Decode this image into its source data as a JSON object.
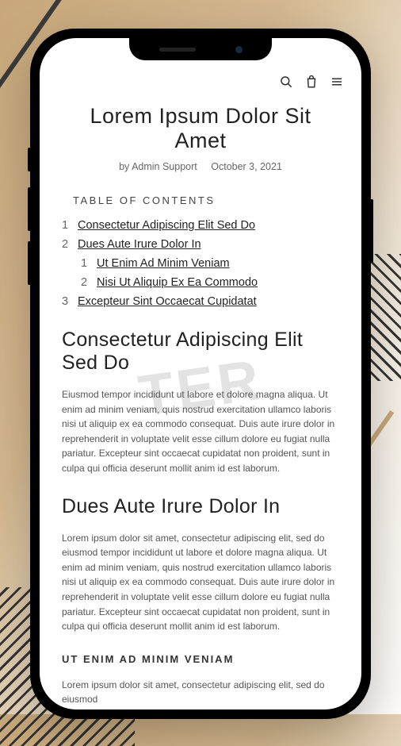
{
  "article": {
    "title": "Lorem Ipsum Dolor Sit Amet",
    "byline_author": "by Admin Support",
    "byline_date": "October 3, 2021"
  },
  "toc": {
    "heading": "TABLE OF CONTENTS",
    "items": {
      "n1": "1",
      "t1": "Consectetur Adipiscing Elit Sed Do",
      "n2": "2",
      "t2": "Dues Aute Irure Dolor In",
      "n2a": "1",
      "t2a": "Ut Enim Ad Minim Veniam",
      "n2b": "2",
      "t2b": "Nisi Ut Aliquip Ex Ea Commodo",
      "n3": "3",
      "t3": "Excepteur Sint Occaecat Cupidatat"
    }
  },
  "sections": {
    "h1": "Consectetur Adipiscing Elit Sed Do",
    "p1": "Eiusmod tempor incididunt ut labore et dolore magna aliqua. Ut enim ad minim veniam, quis nostrud exercitation ullamco laboris nisi ut aliquip ex ea commodo consequat. Duis aute irure dolor in reprehenderit in voluptate velit esse cillum dolore eu fugiat nulla pariatur. Excepteur sint occaecat cupidatat non proident, sunt in culpa qui officia deserunt mollit anim id est laborum.",
    "h2": "Dues Aute Irure Dolor In",
    "p2": "Lorem ipsum dolor sit amet, consectetur adipiscing elit, sed do eiusmod tempor incididunt ut labore et dolore magna aliqua. Ut enim ad minim veniam, quis nostrud exercitation ullamco laboris nisi ut aliquip ex ea commodo consequat. Duis aute irure dolor in reprehenderit in voluptate velit esse cillum dolore eu fugiat nulla pariatur. Excepteur sint occaecat cupidatat non proident, sunt in culpa qui officia deserunt mollit anim id est laborum.",
    "h3": "UT ENIM AD MINIM VENIAM",
    "p3": "Lorem ipsum dolor sit amet, consectetur adipiscing elit, sed do eiusmod"
  },
  "watermark": "TER"
}
